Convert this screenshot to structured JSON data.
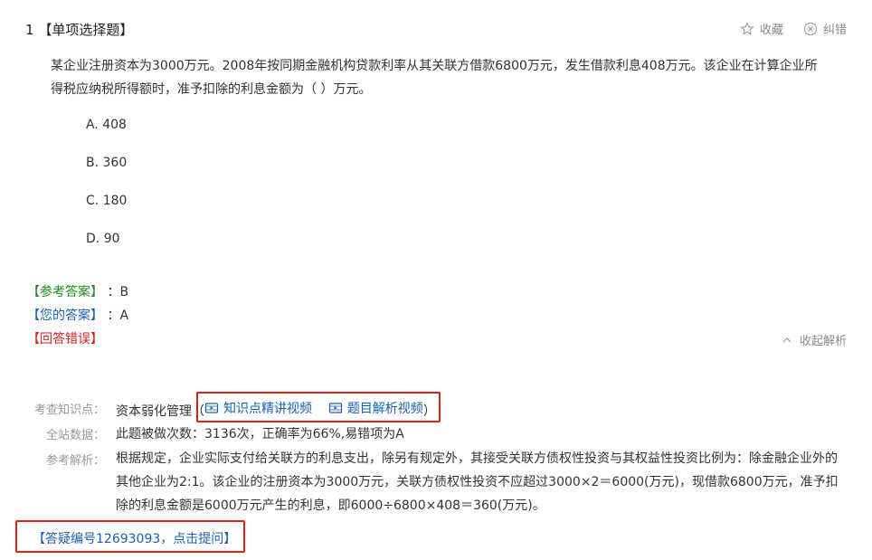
{
  "question": {
    "number": "1",
    "type_label": "【单项选择题】",
    "stem": "某企业注册资本为3000万元。2008年按同期金融机构贷款利率从其关联方借款6800万元，发生借款利息408万元。该企业在计算企业所得税应纳税所得额时，准予扣除的利息金额为（    ）万元。",
    "options": [
      {
        "letter": "A.",
        "text": "408"
      },
      {
        "letter": "B.",
        "text": "360"
      },
      {
        "letter": "C.",
        "text": "180"
      },
      {
        "letter": "D.",
        "text": "90"
      }
    ]
  },
  "actions": {
    "favorite": "收藏",
    "report_error": "纠错",
    "collapse": "收起解析"
  },
  "answer": {
    "reference_label": "【参考答案】",
    "reference_value": "：B",
    "yours_label": "【您的答案】",
    "yours_value": "：A",
    "result": "【回答错误】"
  },
  "analysis": {
    "knowledge_label": "考查知识点：",
    "knowledge_value": "资本弱化管理",
    "paren_open": "（",
    "paren_close": "）",
    "video_knowledge": "知识点精讲视频",
    "video_question": "题目解析视频",
    "stats_label": "全站数据：",
    "stats_value": "此题被做次数：3136次，正确率为66%,易错项为A",
    "explain_label": "参考解析：",
    "explain_text": "根据规定，企业实际支付给关联方的利息支出，除另有规定外，其接受关联方债权性投资与其权益性投资比例为：除金融企业外的其他企业为2:1。该企业的注册资本为3000万元，关联方债权性投资不应超过3000×2＝6000(万元)，现借款6800万元，准予扣除的利息金额是6000万元产生的利息，即6000÷6800×408＝360(万元)。"
  },
  "ask": {
    "label": "【答疑编号12693093，点击提问】"
  },
  "colors": {
    "link_blue": "#1a5fb4",
    "correct_green": "#1e8a1e",
    "error_red": "#d42020",
    "highlight_box": "#e02020"
  }
}
